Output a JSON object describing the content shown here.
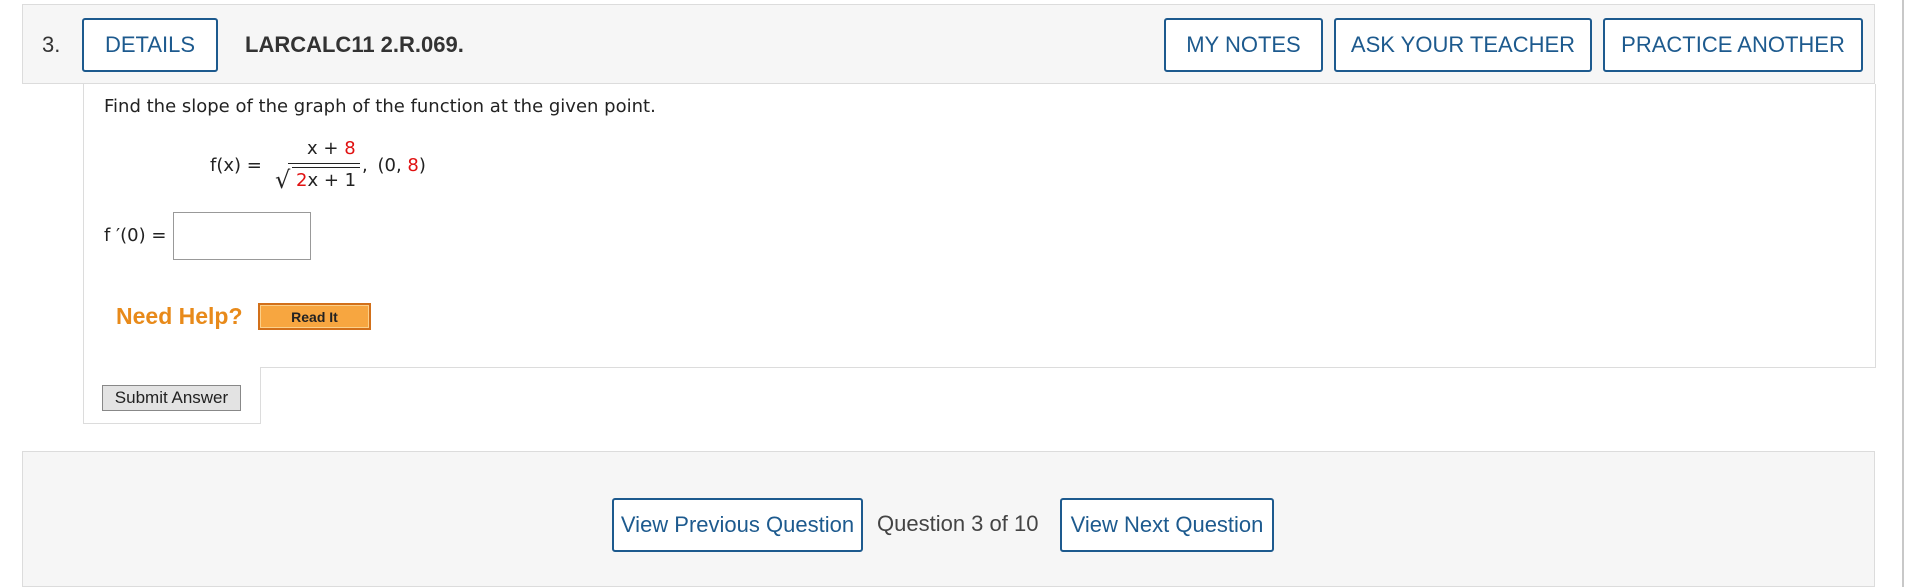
{
  "question": {
    "number": "3.",
    "details_label": "DETAILS",
    "code": "LARCALC11 2.R.069.",
    "my_notes_label": "MY NOTES",
    "ask_teacher_label": "ASK YOUR TEACHER",
    "practice_another_label": "PRACTICE ANOTHER"
  },
  "body": {
    "prompt": "Find the slope of the graph of the function at the given point.",
    "function": {
      "lhs": "f(x) =",
      "numerator_var": "x + ",
      "numerator_const": "8",
      "radical_sign": "√",
      "denominator_coef": "2",
      "denominator_rest": "x + 1",
      "separator": ",",
      "point_open": "(0, ",
      "point_y": "8",
      "point_close": ")"
    },
    "answer": {
      "label": "f ′(0) =",
      "value": "",
      "placeholder": ""
    },
    "need_help_label": "Need Help?",
    "read_it_label": "Read It",
    "submit_label": "Submit Answer"
  },
  "navigation": {
    "previous_label": "View Previous Question",
    "position_text": "Question 3 of 10",
    "next_label": "View Next Question"
  },
  "colors": {
    "accent": "#1d5a8e",
    "randomized_value": "#e01010",
    "help": "#e88a1a",
    "read_it_bg": "#f7a640"
  }
}
